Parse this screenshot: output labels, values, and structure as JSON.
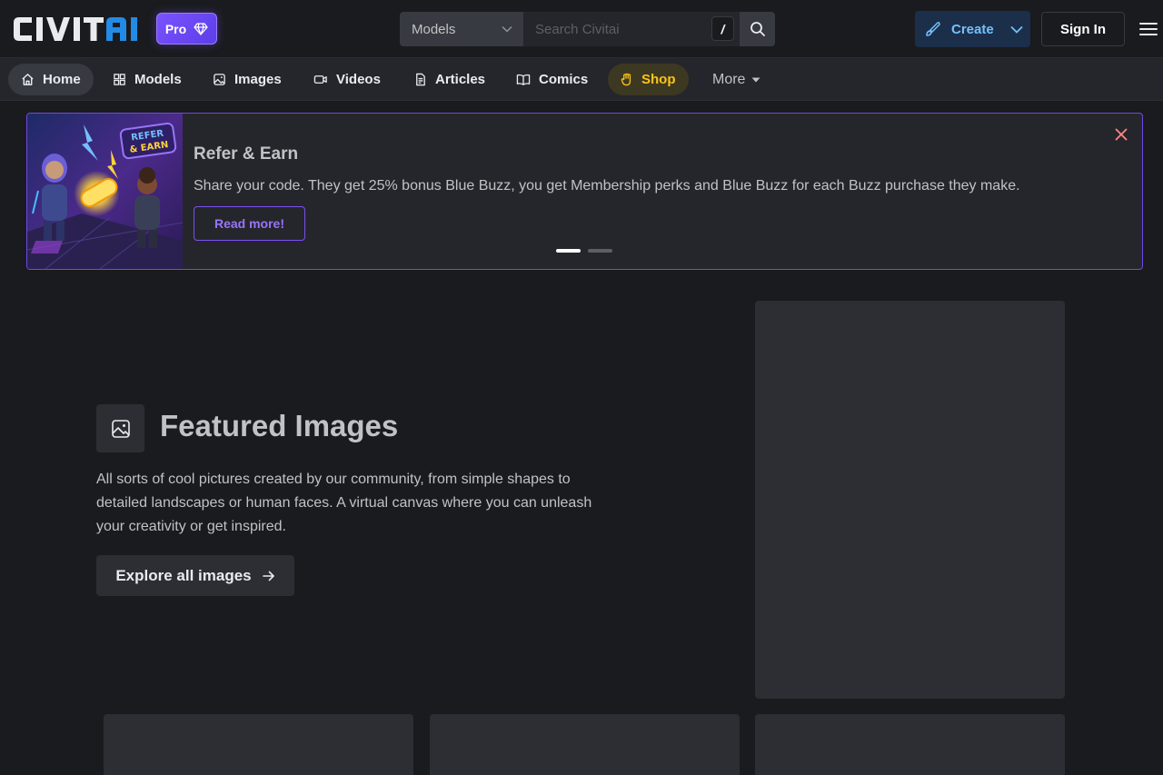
{
  "header": {
    "logo_text": "CIVITAI",
    "pro_badge": "Pro",
    "search": {
      "selected_category": "Models",
      "placeholder": "Search Civitai",
      "shortcut": "/"
    },
    "create_label": "Create",
    "signin_label": "Sign In"
  },
  "nav": {
    "items": [
      {
        "label": "Home",
        "icon": "home-icon"
      },
      {
        "label": "Models",
        "icon": "grid-icon"
      },
      {
        "label": "Images",
        "icon": "photo-icon"
      },
      {
        "label": "Videos",
        "icon": "video-icon"
      },
      {
        "label": "Articles",
        "icon": "article-icon"
      },
      {
        "label": "Comics",
        "icon": "book-icon"
      },
      {
        "label": "Shop",
        "icon": "hand-icon"
      },
      {
        "label": "More",
        "icon": "caret-down-icon"
      }
    ]
  },
  "banner": {
    "title": "Refer & Earn",
    "text": "Share your code. They get 25% bonus Blue Buzz, you get Membership perks and Blue Buzz for each Buzz purchase they make.",
    "button": "Read more!",
    "image_label": "REFER & EARN"
  },
  "featured": {
    "title": "Featured Images",
    "description": "All sorts of cool pictures created by our community, from simple shapes to detailed landscapes or human faces. A virtual canvas where you can unleash your creativity or get inspired.",
    "button": "Explore all images"
  },
  "colors": {
    "background": "#1a1b1e",
    "accent_violet": "#7950f2",
    "create_blue": "#74c0fc",
    "shop_yellow": "#fcc419"
  }
}
